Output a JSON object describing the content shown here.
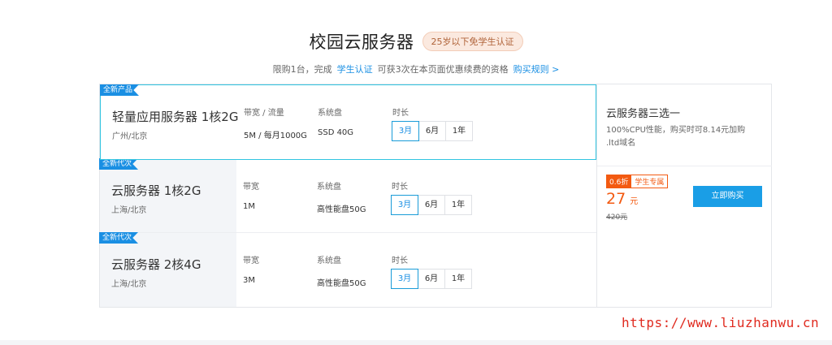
{
  "header": {
    "title": "校园云服务器",
    "badge": "25岁以下免学生认证",
    "sub_prefix": "限购1台，完成",
    "sub_link": "学生认证",
    "sub_middle": "可获3次在本页面优惠续费的资格",
    "sub_rule_link": "购买规则 >"
  },
  "products": [
    {
      "tag": "全新产品",
      "name": "轻量应用服务器 1核2G",
      "region": "广州/北京",
      "col1_label": "带宽 / 流量",
      "col1_value": "5M / 每月1000G",
      "col2_label": "系统盘",
      "col2_value": "SSD 40G",
      "duration_label": "时长",
      "durations": [
        "3月",
        "6月",
        "1年"
      ],
      "selected_duration": "3月"
    },
    {
      "tag": "全新代次",
      "name": "云服务器 1核2G",
      "region": "上海/北京",
      "col1_label": "带宽",
      "col1_value": "1M",
      "col2_label": "系统盘",
      "col2_value": "高性能盘50G",
      "duration_label": "时长",
      "durations": [
        "3月",
        "6月",
        "1年"
      ],
      "selected_duration": "3月"
    },
    {
      "tag": "全新代次",
      "name": "云服务器 2核4G",
      "region": "上海/北京",
      "col1_label": "带宽",
      "col1_value": "3M",
      "col2_label": "系统盘",
      "col2_value": "高性能盘50G",
      "duration_label": "时长",
      "durations": [
        "3月",
        "6月",
        "1年"
      ],
      "selected_duration": "3月"
    }
  ],
  "side": {
    "title": "云服务器三选一",
    "desc": "100%CPU性能，购买时可8.14元加购 .ltd域名",
    "discount_badge": "0.6折",
    "student_badge": "学生专属",
    "price": "27",
    "price_unit": "元",
    "original_price": "420元",
    "buy_label": "立即购买"
  },
  "watermark": "https://www.liuzhanwu.cn",
  "colors": {
    "accent": "#1a8fe3",
    "selected_border": "#31c4e0",
    "price": "#f35a11",
    "buy_button": "#1a9ee6",
    "watermark": "#e02b20"
  }
}
